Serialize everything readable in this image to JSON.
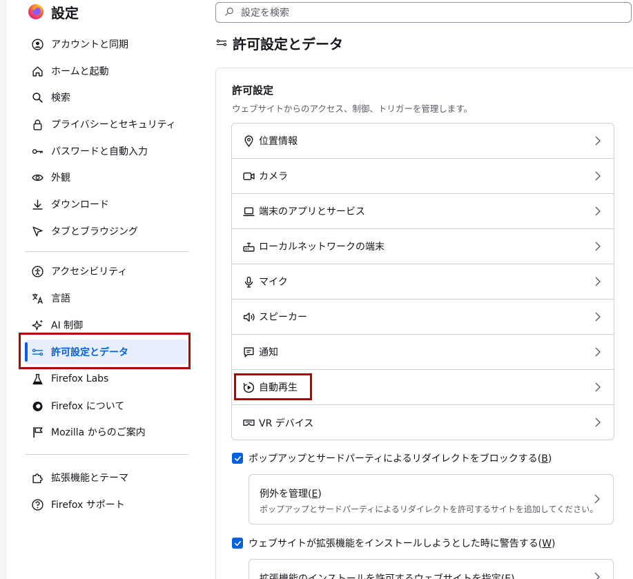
{
  "app": {
    "title": "設定"
  },
  "sidebar": {
    "items": [
      {
        "label": "アカウントと同期",
        "icon": "account-icon"
      },
      {
        "label": "ホームと起動",
        "icon": "home-icon"
      },
      {
        "label": "検索",
        "icon": "search-icon"
      },
      {
        "label": "プライバシーとセキュリティ",
        "icon": "lock-icon"
      },
      {
        "label": "パスワードと自動入力",
        "icon": "key-icon"
      },
      {
        "label": "外観",
        "icon": "eye-icon"
      },
      {
        "label": "ダウンロード",
        "icon": "download-icon"
      },
      {
        "label": "タブとブラウジング",
        "icon": "pointer-icon"
      },
      {
        "label": "アクセシビリティ",
        "icon": "accessibility-icon"
      },
      {
        "label": "言語",
        "icon": "translate-icon"
      },
      {
        "label": "AI 制御",
        "icon": "sparkle-icon"
      },
      {
        "label": "許可設定とデータ",
        "icon": "permissions-icon",
        "active": true
      },
      {
        "label": "Firefox Labs",
        "icon": "flask-icon"
      },
      {
        "label": "Firefox について",
        "icon": "firefox-icon"
      },
      {
        "label": "Mozilla からのご案内",
        "icon": "mozilla-flag-icon"
      },
      {
        "label": "拡張機能とテーマ",
        "icon": "puzzle-icon"
      },
      {
        "label": "Firefox サポート",
        "icon": "help-icon"
      }
    ]
  },
  "search": {
    "placeholder": "設定を検索"
  },
  "main": {
    "heading": "許可設定とデータ",
    "section": {
      "title": "許可設定",
      "description": "ウェブサイトからのアクセス、制御、トリガーを管理します。",
      "permissions": [
        {
          "label": "位置情報",
          "icon": "location-icon"
        },
        {
          "label": "カメラ",
          "icon": "camera-icon"
        },
        {
          "label": "端末のアプリとサービス",
          "icon": "laptop-icon"
        },
        {
          "label": "ローカルネットワークの端末",
          "icon": "router-icon"
        },
        {
          "label": "マイク",
          "icon": "microphone-icon"
        },
        {
          "label": "スピーカー",
          "icon": "speaker-icon"
        },
        {
          "label": "通知",
          "icon": "notification-icon"
        },
        {
          "label": "自動再生",
          "icon": "autoplay-icon"
        },
        {
          "label": "VR デバイス",
          "icon": "vr-headset-icon"
        }
      ],
      "block_popups": {
        "label": "ポップアップとサードパーティによるリダイレクトをブロックする(",
        "accesskey": "B",
        "suffix": ")",
        "checked": true
      },
      "popup_exceptions": {
        "title_prefix": "例外を管理(",
        "accesskey": "E",
        "title_suffix": ")",
        "description": "ポップアップとサードパーティによるリダイレクトを許可するサイトを追加してください。"
      },
      "warn_addons": {
        "label": "ウェブサイトが拡張機能をインストールしようとした時に警告する(",
        "accesskey": "W",
        "suffix": ")",
        "checked": true
      },
      "addon_exceptions": {
        "title_prefix": "拡張機能のインストールを許可するウェブサイトを指定(",
        "accesskey": "E",
        "title_suffix": ")"
      }
    }
  },
  "colors": {
    "accent": "#0061e0",
    "highlight": "#b00000",
    "active_bg": "#e7eefc"
  }
}
